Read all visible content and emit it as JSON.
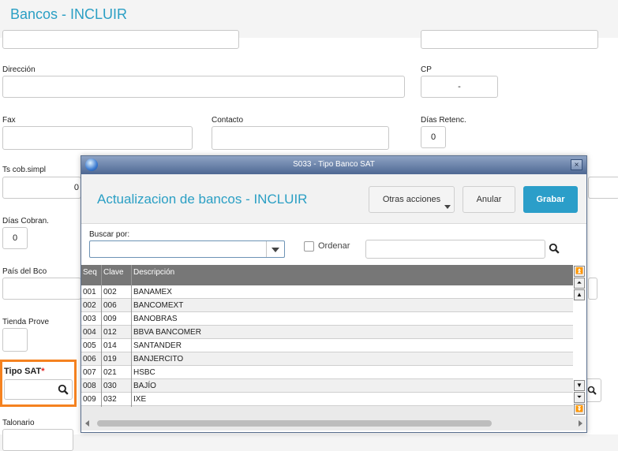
{
  "header": {
    "title": "Bancos - INCLUIR"
  },
  "form": {
    "direccion_label": "Dirección",
    "cp_label": "CP",
    "cp_value": "-",
    "fax_label": "Fax",
    "contacto_label": "Contacto",
    "dias_retenc_label": "Días Retenc.",
    "dias_retenc_value": "0",
    "ts_cob_simpl_label": "Ts cob.simpl",
    "ts_partial": "0",
    "dias_cobran_label": "Días Cobran.",
    "dias_cobran_value": "0",
    "pais_label": "País del Bco",
    "tienda_label": "Tienda Prove",
    "tipo_sat_label": "Tipo SAT",
    "tipo_sat_required": "*",
    "talonario_label": "Talonario"
  },
  "modal": {
    "title": "S033 - Tipo Banco SAT",
    "close": "×",
    "heading": "Actualizacion de bancos - INCLUIR",
    "buttons": {
      "otras": "Otras acciones",
      "anular": "Anular",
      "grabar": "Grabar"
    },
    "buscar_label": "Buscar por:",
    "buscar_value": "",
    "ordenar_label": "Ordenar",
    "search_value": "",
    "columns": [
      "Seq",
      "Clave",
      "Descripción"
    ],
    "rows": [
      {
        "seq": "001",
        "clave": "002",
        "desc": "BANAMEX"
      },
      {
        "seq": "002",
        "clave": "006",
        "desc": "BANCOMEXT"
      },
      {
        "seq": "003",
        "clave": "009",
        "desc": "BANOBRAS"
      },
      {
        "seq": "004",
        "clave": "012",
        "desc": "BBVA BANCOMER"
      },
      {
        "seq": "005",
        "clave": "014",
        "desc": "SANTANDER"
      },
      {
        "seq": "006",
        "clave": "019",
        "desc": "BANJERCITO"
      },
      {
        "seq": "007",
        "clave": "021",
        "desc": "HSBC"
      },
      {
        "seq": "008",
        "clave": "030",
        "desc": "BAJÍO"
      },
      {
        "seq": "009",
        "clave": "032",
        "desc": "IXE"
      }
    ]
  }
}
